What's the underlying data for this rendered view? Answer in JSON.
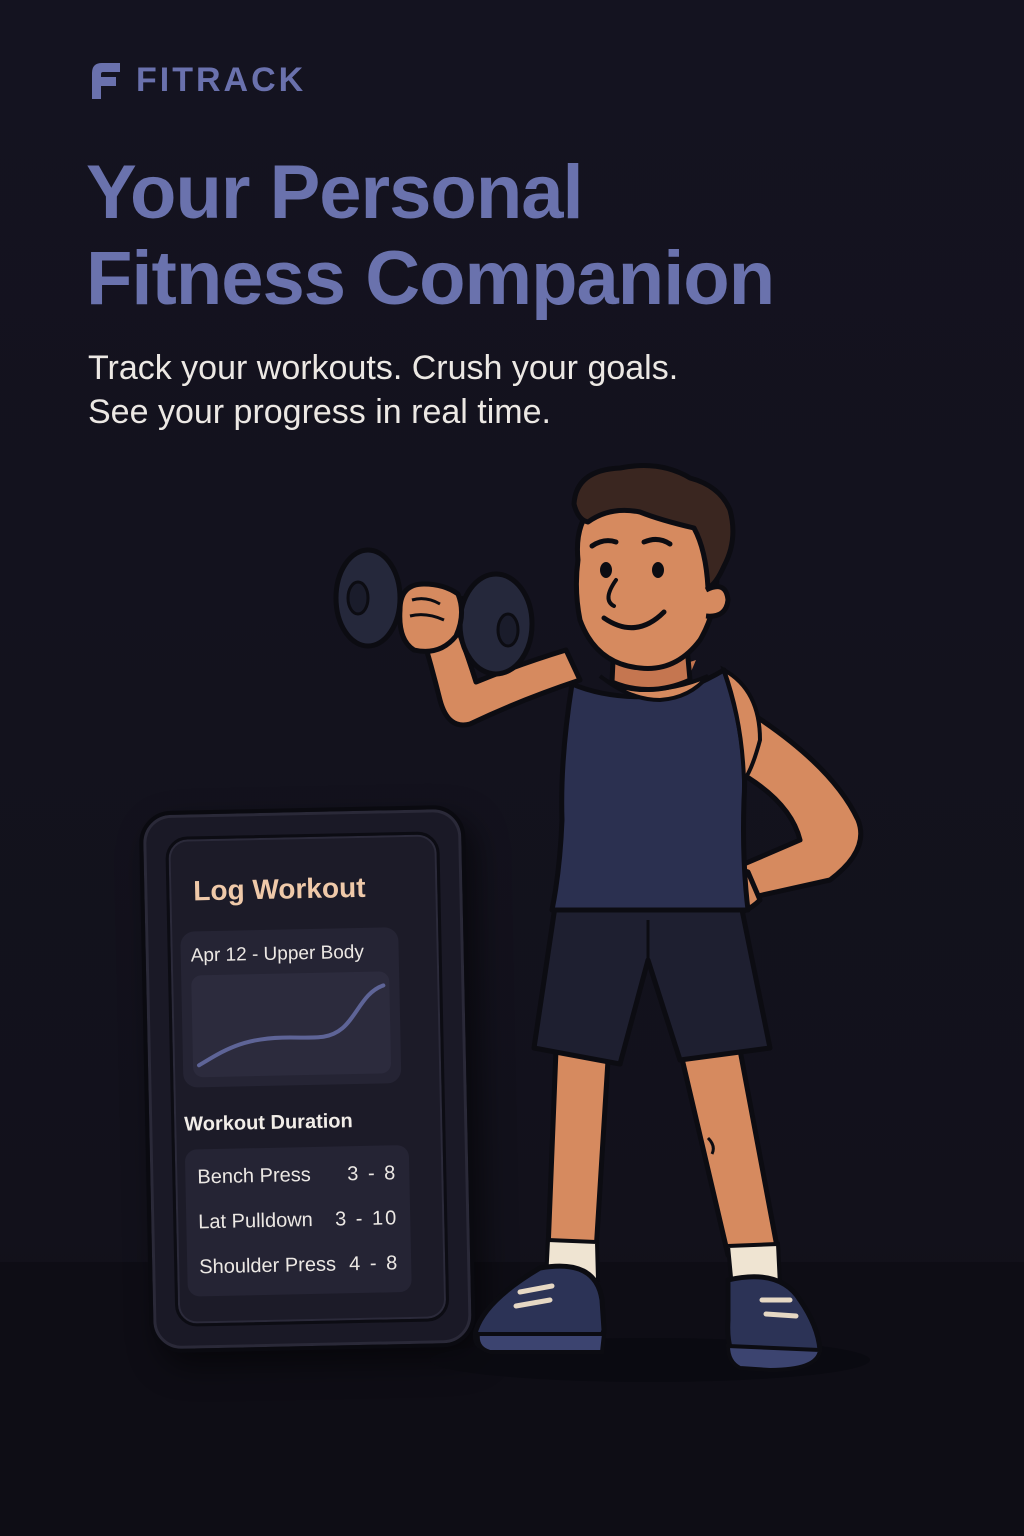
{
  "brand": {
    "name": "FITRACK",
    "logo_icon": "fitrack-logo-icon",
    "color": "#6a71ad"
  },
  "hero": {
    "headline_line1": "Your Personal",
    "headline_line2": "Fitness Companion",
    "subhead_line1": "Track your workouts. Crush your goals.",
    "subhead_line2": "See your progress in real time."
  },
  "phone": {
    "screen_title": "Log Workout",
    "session_label": "Apr 12 - Upper Body",
    "duration_title": "Workout Duration",
    "exercises": [
      {
        "name": "Bench Press",
        "sets": "3 - 8"
      },
      {
        "name": "Lat Pulldown",
        "sets": "3 - 10"
      },
      {
        "name": "Shoulder Press",
        "sets": "4 - 8"
      }
    ]
  },
  "colors": {
    "background": "#13121d",
    "accent": "#6a72ad",
    "phone_title": "#efc9a9",
    "skin": "#d68a5f",
    "tank_top": "#2b3050",
    "shorts": "#1e1f30",
    "shoes": "#2c3356"
  }
}
